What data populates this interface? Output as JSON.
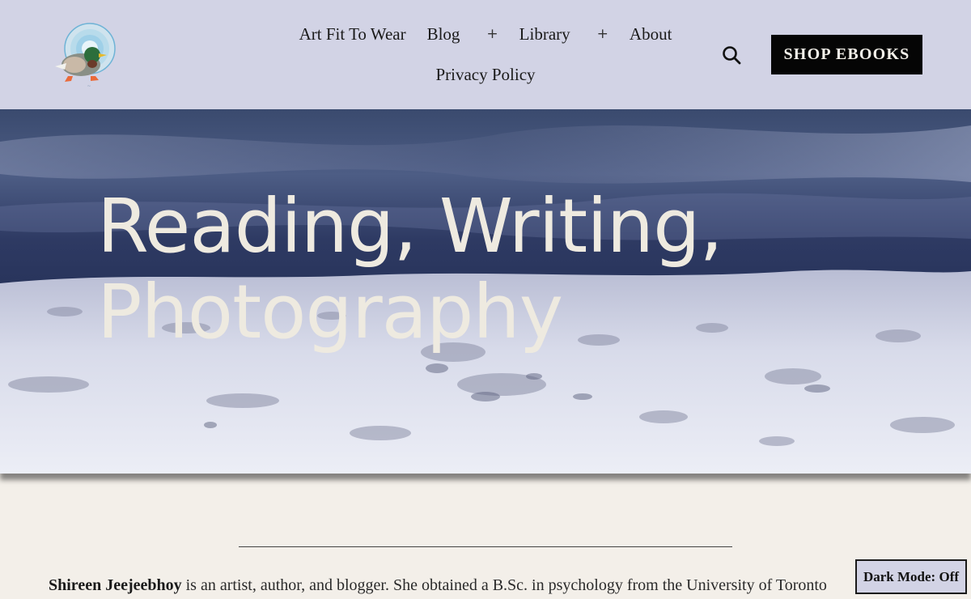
{
  "nav": {
    "items": [
      {
        "label": "Art Fit To Wear"
      },
      {
        "label": "Blog",
        "expander": "+"
      },
      {
        "label": "Library",
        "expander": "+"
      },
      {
        "label": "About"
      },
      {
        "label": "Privacy Policy"
      }
    ]
  },
  "header": {
    "search_icon": "search-icon",
    "shop_label": "SHOP EBOOKS",
    "logo_icon": "duck-logo-icon"
  },
  "hero": {
    "title_line1": "Reading, Writing,",
    "title_line2": "Photography"
  },
  "bio": {
    "name": "Shireen Jeejeebhoy",
    "text": " is an artist, author, and blogger. She obtained a B.Sc. in psychology from the University of Toronto"
  },
  "dark_mode": {
    "label": "Dark Mode: Off"
  },
  "colors": {
    "header_bg": "#d2d3e5",
    "page_bg": "#f3efe9",
    "button_bg": "#050505",
    "hero_text": "#eeeae0"
  }
}
